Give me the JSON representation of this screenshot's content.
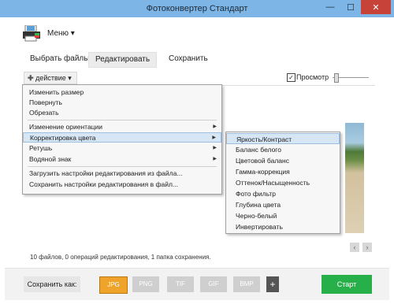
{
  "window": {
    "title": "Фотоконвертер Стандарт",
    "min": "—",
    "max": "☐",
    "close": "✕"
  },
  "menu": {
    "label": "Меню ▾"
  },
  "tabs": [
    {
      "label": "Выбрать файлы"
    },
    {
      "label": "Редактировать"
    },
    {
      "label": "Сохранить"
    }
  ],
  "toolbar": {
    "action_label": "действие ▾",
    "preview_label": "Просмотр",
    "preview_checked": "✓"
  },
  "menu_items": [
    {
      "label": "Изменить размер"
    },
    {
      "label": "Повернуть"
    },
    {
      "label": "Обрезать"
    },
    {
      "label": "Изменение ориентации"
    },
    {
      "label": "Корректировка цвета"
    },
    {
      "label": "Ретушь"
    },
    {
      "label": "Водяной знак"
    },
    {
      "label": "Загрузить настройки редактирования из файла..."
    },
    {
      "label": "Сохранить настройки редактирования в файл..."
    }
  ],
  "submenu_items": [
    {
      "label": "Яркость/Контраст"
    },
    {
      "label": "Баланс белого"
    },
    {
      "label": "Цветовой баланс"
    },
    {
      "label": "Гамма-коррекция"
    },
    {
      "label": "Оттенок/Насыщенность"
    },
    {
      "label": "Фото фильтр"
    },
    {
      "label": "Глубина цвета"
    },
    {
      "label": "Черно-белый"
    },
    {
      "label": "Инвертировать"
    }
  ],
  "status": {
    "text": "10 файлов, 0 операций редактирования, 1 папка сохранения."
  },
  "nav": {
    "prev": "‹",
    "next": "›"
  },
  "save": {
    "label": "Сохранить как:",
    "formats": [
      "JPG",
      "PNG",
      "TIF",
      "GIF",
      "BMP"
    ],
    "add": "+",
    "start": "Старт"
  },
  "colors": {
    "titlebar": "#7db5e6",
    "accent": "#f0a32b",
    "start": "#27b04a",
    "close": "#c7433a"
  }
}
